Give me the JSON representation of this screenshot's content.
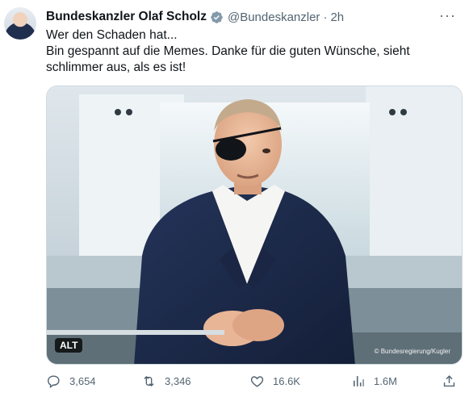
{
  "author": {
    "name": "Bundeskanzler Olaf Scholz",
    "handle": "@Bundeskanzler",
    "separator": "·",
    "time": "2h",
    "verified": true
  },
  "more_label": "···",
  "tweet_text": [
    "Wer den Schaden hat...",
    "Bin gespannt auf die Memes. Danke für die guten Wünsche, sieht schlimmer aus, als es ist!"
  ],
  "media": {
    "alt_badge": "ALT",
    "credit": "© Bundesregierung/Kugler"
  },
  "actions": {
    "replies": "3,654",
    "retweets": "3,346",
    "likes": "16.6K",
    "views": "1.6M"
  },
  "colors": {
    "text": "#0f1419",
    "secondary": "#536471",
    "verified_badge": "#829aab",
    "suit": "#1d2a45"
  }
}
